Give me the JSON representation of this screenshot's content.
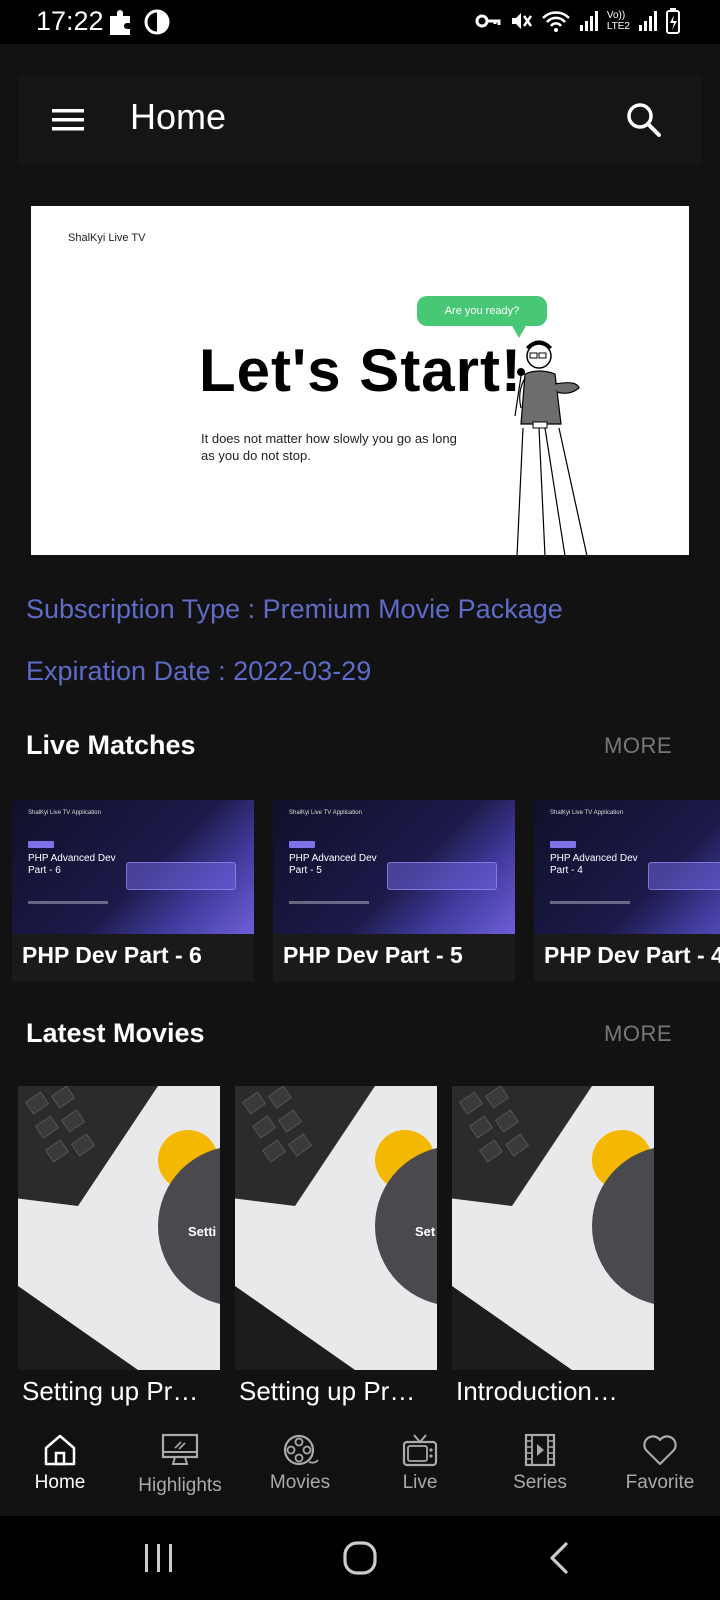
{
  "status_bar": {
    "time": "17:22",
    "network_label": "LTE2",
    "volte_label": "Vo))"
  },
  "app_bar": {
    "title": "Home",
    "menu_icon": "menu-icon",
    "search_icon": "search-icon"
  },
  "banner": {
    "brand": "ShalKyi Live TV",
    "bubble": "Are you ready?",
    "headline": "Let's Start!",
    "quote": "It does not matter how slowly you go as long as you do not stop."
  },
  "subscription": {
    "type_line": "Subscription Type : Premium Movie Package",
    "expiration_line": "Expiration Date : 2022-03-29"
  },
  "live_matches": {
    "title": "Live Matches",
    "more": "MORE",
    "items": [
      {
        "label": "PHP Dev Part - 6",
        "thumb_brand": "ShalKyi Live TV Application",
        "thumb_title": "PHP Advanced Dev Part - 6"
      },
      {
        "label": "PHP Dev Part - 5",
        "thumb_brand": "ShalKyi Live TV Application",
        "thumb_title": "PHP Advanced Dev Part - 5"
      },
      {
        "label": "PHP Dev Part - 4",
        "thumb_brand": "ShalKyi Live TV Application",
        "thumb_title": "PHP Advanced Dev Part - 4"
      }
    ]
  },
  "latest_movies": {
    "title": "Latest Movies",
    "more": "MORE",
    "items": [
      {
        "label": "Setting up Pr…",
        "thumb_text": "Setti"
      },
      {
        "label": "Setting up Pr…",
        "thumb_text": "Set"
      },
      {
        "label": "Introduction…",
        "thumb_text": ""
      }
    ]
  },
  "bottom_nav": {
    "items": [
      {
        "label": "Home",
        "icon": "home-icon",
        "active": true
      },
      {
        "label": "Highlights",
        "icon": "monitor-icon",
        "active": false
      },
      {
        "label": "Movies",
        "icon": "film-reel-icon",
        "active": false
      },
      {
        "label": "Live",
        "icon": "tv-icon",
        "active": false
      },
      {
        "label": "Series",
        "icon": "film-strip-icon",
        "active": false
      },
      {
        "label": "Favorite",
        "icon": "heart-icon",
        "active": false
      }
    ]
  },
  "colors": {
    "background": "#121212",
    "accent_text": "#5f6bc8",
    "bubble_green": "#48c774",
    "more_gray": "#777777"
  }
}
